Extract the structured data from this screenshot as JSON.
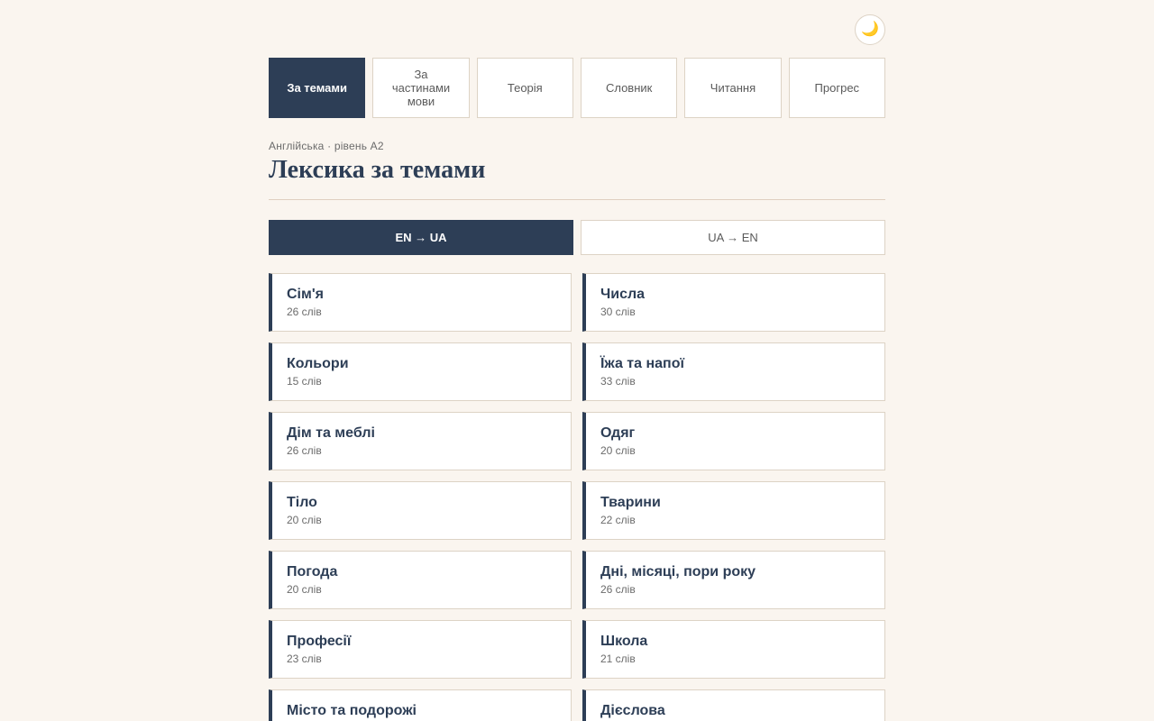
{
  "header": {
    "theme_toggle_icon": "🌙",
    "theme_toggle_icon_name": "moon-icon"
  },
  "nav": {
    "tabs": [
      {
        "label": "За темами",
        "active": true
      },
      {
        "label": "За частинами мови",
        "active": false
      },
      {
        "label": "Теорія",
        "active": false
      },
      {
        "label": "Словник",
        "active": false
      },
      {
        "label": "Читання",
        "active": false
      },
      {
        "label": "Прогрес",
        "active": false
      }
    ]
  },
  "page": {
    "eyebrow": "Англійська · рівень A2",
    "title": "Лексика за темами"
  },
  "direction": {
    "options": [
      {
        "label": "EN → UA",
        "active": true
      },
      {
        "label": "UA → EN",
        "active": false
      }
    ]
  },
  "topics": [
    {
      "name": "Сім'я",
      "count": "26 слів"
    },
    {
      "name": "Числа",
      "count": "30 слів"
    },
    {
      "name": "Кольори",
      "count": "15 слів"
    },
    {
      "name": "Їжа та напої",
      "count": "33 слів"
    },
    {
      "name": "Дім та меблі",
      "count": "26 слів"
    },
    {
      "name": "Одяг",
      "count": "20 слів"
    },
    {
      "name": "Тіло",
      "count": "20 слів"
    },
    {
      "name": "Тварини",
      "count": "22 слів"
    },
    {
      "name": "Погода",
      "count": "20 слів"
    },
    {
      "name": "Дні, місяці, пори року",
      "count": "26 слів"
    },
    {
      "name": "Професії",
      "count": "23 слів"
    },
    {
      "name": "Школа",
      "count": "21 слів"
    },
    {
      "name": "Місто та подорожі",
      "count": ""
    },
    {
      "name": "Дієслова",
      "count": ""
    }
  ],
  "colors": {
    "accent": "#2d3e56",
    "background": "#faf5ef",
    "border": "#ddd3c5"
  }
}
